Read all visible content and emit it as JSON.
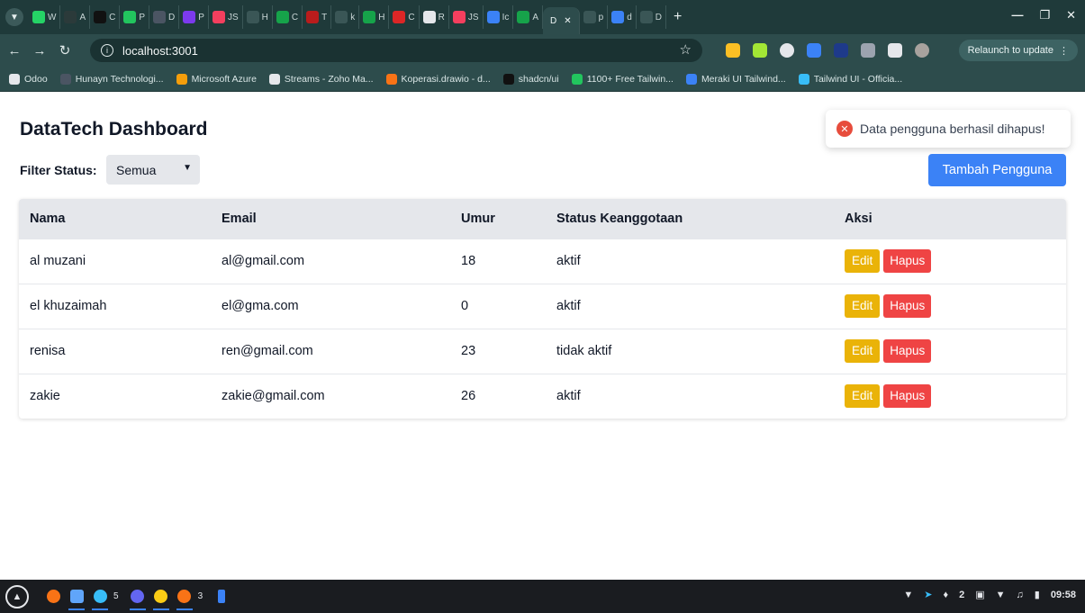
{
  "browser": {
    "tabs": [
      {
        "label": "W",
        "color": "#25d366"
      },
      {
        "label": "A",
        "color": "#2b3a3a"
      },
      {
        "label": "C",
        "color": "#111111"
      },
      {
        "label": "P",
        "color": "#22c55e"
      },
      {
        "label": "D",
        "color": "#4b5563"
      },
      {
        "label": "P",
        "color": "#7c3aed"
      },
      {
        "label": "JS",
        "color": "#f43f5e"
      },
      {
        "label": "H",
        "color": "#3a5656"
      },
      {
        "label": "C",
        "color": "#16a34a"
      },
      {
        "label": "T",
        "color": "#b91c1c"
      },
      {
        "label": "k",
        "color": "#3a5656"
      },
      {
        "label": "H",
        "color": "#16a34a"
      },
      {
        "label": "C",
        "color": "#dc2626"
      },
      {
        "label": "R",
        "color": "#e5e7eb"
      },
      {
        "label": "JS",
        "color": "#f43f5e"
      },
      {
        "label": "Ic",
        "color": "#3b82f6"
      },
      {
        "label": "A",
        "color": "#16a34a"
      }
    ],
    "active_tab": {
      "label": "D"
    },
    "tabs_after": [
      {
        "label": "p",
        "color": "#3a5656"
      },
      {
        "label": "d",
        "color": "#3b82f6"
      },
      {
        "label": "D",
        "color": "#3a5656"
      }
    ],
    "url": "localhost:3001",
    "relaunch_label": "Relaunch to update",
    "bookmarks": [
      {
        "label": "Odoo",
        "color": "#e5e7eb"
      },
      {
        "label": "Hunayn Technologi...",
        "color": "#4b5563"
      },
      {
        "label": "Microsoft Azure",
        "color": "#f59e0b"
      },
      {
        "label": "Streams - Zoho Ma...",
        "color": "#e5e7eb"
      },
      {
        "label": "Koperasi.drawio - d...",
        "color": "#f97316"
      },
      {
        "label": "shadcn/ui",
        "color": "#111111"
      },
      {
        "label": "1100+ Free Tailwin...",
        "color": "#22c55e"
      },
      {
        "label": "Meraki UI Tailwind...",
        "color": "#3b82f6"
      },
      {
        "label": "Tailwind UI - Officia...",
        "color": "#38bdf8"
      }
    ]
  },
  "page": {
    "title": "DataTech Dashboard",
    "filter_label": "Filter Status:",
    "filter_value": "Semua",
    "add_button": "Tambah Pengguna",
    "toast": "Data pengguna berhasil dihapus!",
    "table": {
      "headers": [
        "Nama",
        "Email",
        "Umur",
        "Status Keanggotaan",
        "Aksi"
      ],
      "rows": [
        {
          "nama": "al muzani",
          "email": "al@gmail.com",
          "umur": "18",
          "status": "aktif"
        },
        {
          "nama": "el khuzaimah",
          "email": "el@gma.com",
          "umur": "0",
          "status": "aktif"
        },
        {
          "nama": "renisa",
          "email": "ren@gmail.com",
          "umur": "23",
          "status": "tidak aktif"
        },
        {
          "nama": "zakie",
          "email": "zakie@gmail.com",
          "umur": "26",
          "status": "aktif"
        }
      ],
      "edit_label": "Edit",
      "delete_label": "Hapus"
    }
  },
  "taskbar": {
    "badge_telegram": "5",
    "badge_apps": "3",
    "tray_count": "2",
    "clock": "09:58"
  }
}
